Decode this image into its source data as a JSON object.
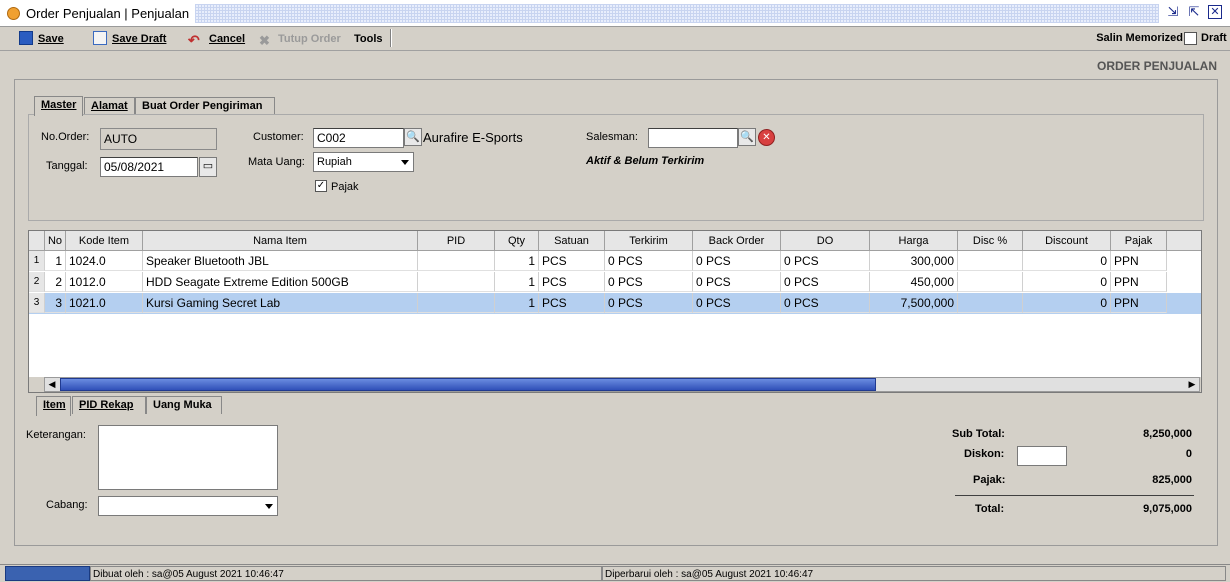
{
  "window": {
    "title": "Order Penjualan | Penjualan"
  },
  "toolbar": {
    "save": "Save",
    "save_draft": "Save Draft",
    "cancel": "Cancel",
    "tutup_order": "Tutup Order",
    "tools": "Tools",
    "salin_memorized": "Salin Memorized",
    "draft": "Draft"
  },
  "page_heading": "ORDER PENJUALAN",
  "tabs_top": [
    "Master",
    "Alamat",
    "Buat Order Pengiriman"
  ],
  "master": {
    "no_order_label": "No.Order:",
    "no_order_value": "AUTO",
    "tanggal_label": "Tanggal:",
    "tanggal_value": "05/08/2021",
    "customer_label": "Customer:",
    "customer_code": "C002",
    "customer_name": "Aurafire E-Sports",
    "mata_uang_label": "Mata Uang:",
    "mata_uang_value": "Rupiah",
    "pajak_label": "Pajak",
    "pajak_checked": true,
    "salesman_label": "Salesman:",
    "salesman_value": "",
    "status_text": "Aktif & Belum Terkirim"
  },
  "grid": {
    "columns": [
      "No",
      "Kode Item",
      "Nama Item",
      "PID",
      "Qty",
      "Satuan",
      "Terkirim",
      "Back Order",
      "DO",
      "Harga",
      "Disc %",
      "Discount",
      "Pajak"
    ],
    "rows": [
      {
        "idx": "1",
        "no": "1",
        "kode": "1024.0",
        "nama": "Speaker Bluetooth JBL",
        "pid": "",
        "qty": "1",
        "satuan": "PCS",
        "terkirim": "0 PCS",
        "back_order": "0 PCS",
        "do": "0 PCS",
        "harga": "300,000",
        "disc_pct": "",
        "discount": "0",
        "pajak": "PPN"
      },
      {
        "idx": "2",
        "no": "2",
        "kode": "1012.0",
        "nama": "HDD Seagate Extreme Edition 500GB",
        "pid": "",
        "qty": "1",
        "satuan": "PCS",
        "terkirim": "0 PCS",
        "back_order": "0 PCS",
        "do": "0 PCS",
        "harga": "450,000",
        "disc_pct": "",
        "discount": "0",
        "pajak": "PPN"
      },
      {
        "idx": "3",
        "no": "3",
        "kode": "1021.0",
        "nama": "Kursi Gaming Secret Lab",
        "pid": "",
        "qty": "1",
        "satuan": "PCS",
        "terkirim": "0 PCS",
        "back_order": "0 PCS",
        "do": "0 PCS",
        "harga": "7,500,000",
        "disc_pct": "",
        "discount": "0",
        "pajak": "PPN"
      }
    ]
  },
  "tabs_bottom": [
    "Item",
    "PID Rekap",
    "Uang Muka"
  ],
  "bottom": {
    "keterangan_label": "Keterangan:",
    "cabang_label": "Cabang:"
  },
  "summary": {
    "sub_total_label": "Sub Total:",
    "sub_total_value": "8,250,000",
    "diskon_label": "Diskon:",
    "diskon_value": "0",
    "pajak_label": "Pajak:",
    "pajak_value": "825,000",
    "total_label": "Total:",
    "total_value": "9,075,000"
  },
  "status": {
    "created": "Dibuat oleh : sa@05 August 2021  10:46:47",
    "updated": "Diperbarui oleh : sa@05 August 2021  10:46:47"
  }
}
